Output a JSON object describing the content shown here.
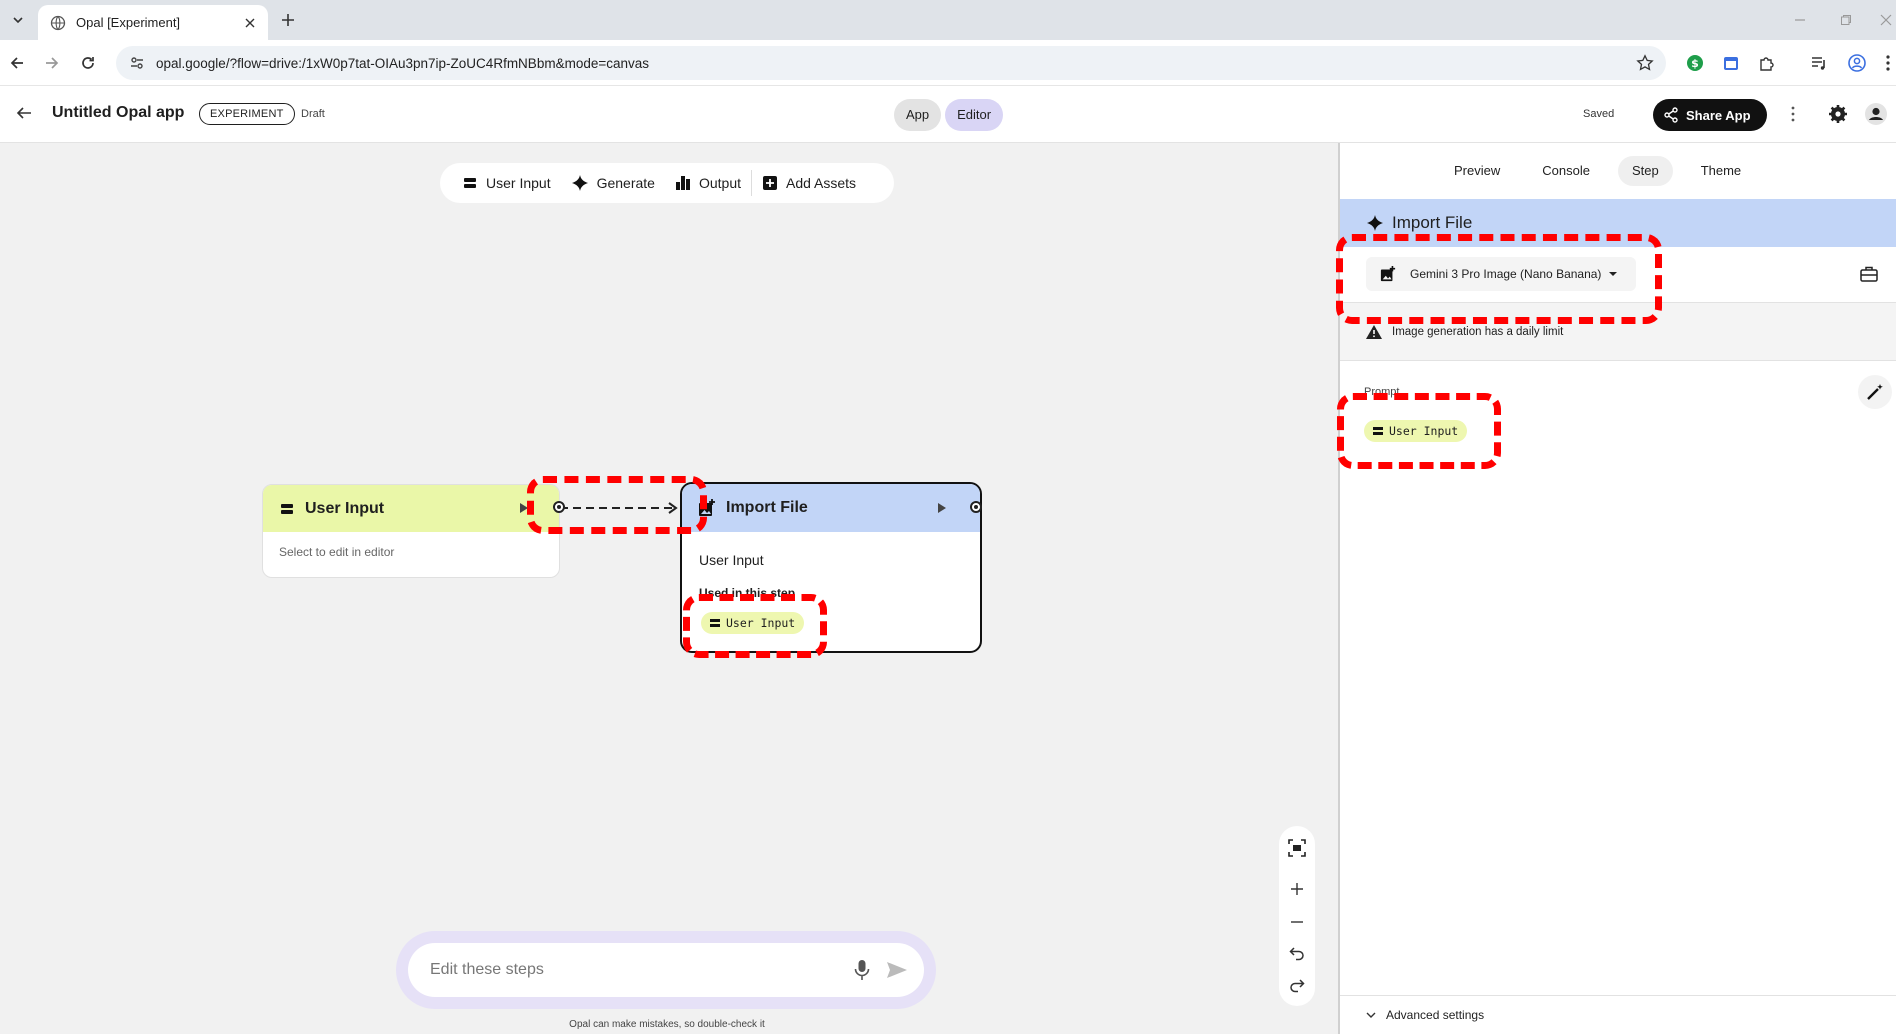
{
  "browser": {
    "tab_title": "Opal [Experiment]",
    "url": "opal.google/?flow=drive:/1xW0p7tat-OIAu3pn7ip-ZoUC4RfmNBbm&mode=canvas"
  },
  "header": {
    "title": "Untitled Opal app",
    "badge": "EXPERIMENT",
    "status": "Draft",
    "mode_app": "App",
    "mode_editor": "Editor",
    "save_status": "Saved",
    "share_label": "Share App"
  },
  "canvas_toolbar": {
    "user_input": "User Input",
    "generate": "Generate",
    "output": "Output",
    "add_assets": "Add Assets"
  },
  "nodes": {
    "user_input": {
      "title": "User Input",
      "hint": "Select to edit in editor"
    },
    "import_file": {
      "title": "Import File",
      "line": "User Input",
      "used_label": "Used in this step",
      "chip": "User Input"
    }
  },
  "prompt_bar": {
    "placeholder": "Edit these steps",
    "disclaimer": "Opal can make mistakes, so double-check it"
  },
  "panel": {
    "tabs": [
      "Preview",
      "Console",
      "Step",
      "Theme"
    ],
    "active_tab": "Step",
    "step_title": "Import File",
    "model": "Gemini 3 Pro Image (Nano Banana)",
    "limit_note": "Image generation has a daily limit",
    "prompt_label": "Prompt",
    "prompt_chip": "User Input",
    "advanced": "Advanced settings"
  },
  "colors": {
    "user_input_node": "#eaf7a8",
    "import_node": "#c2d5f7",
    "annotation": "#ff0000",
    "editor_pill": "#d9d5f5"
  }
}
